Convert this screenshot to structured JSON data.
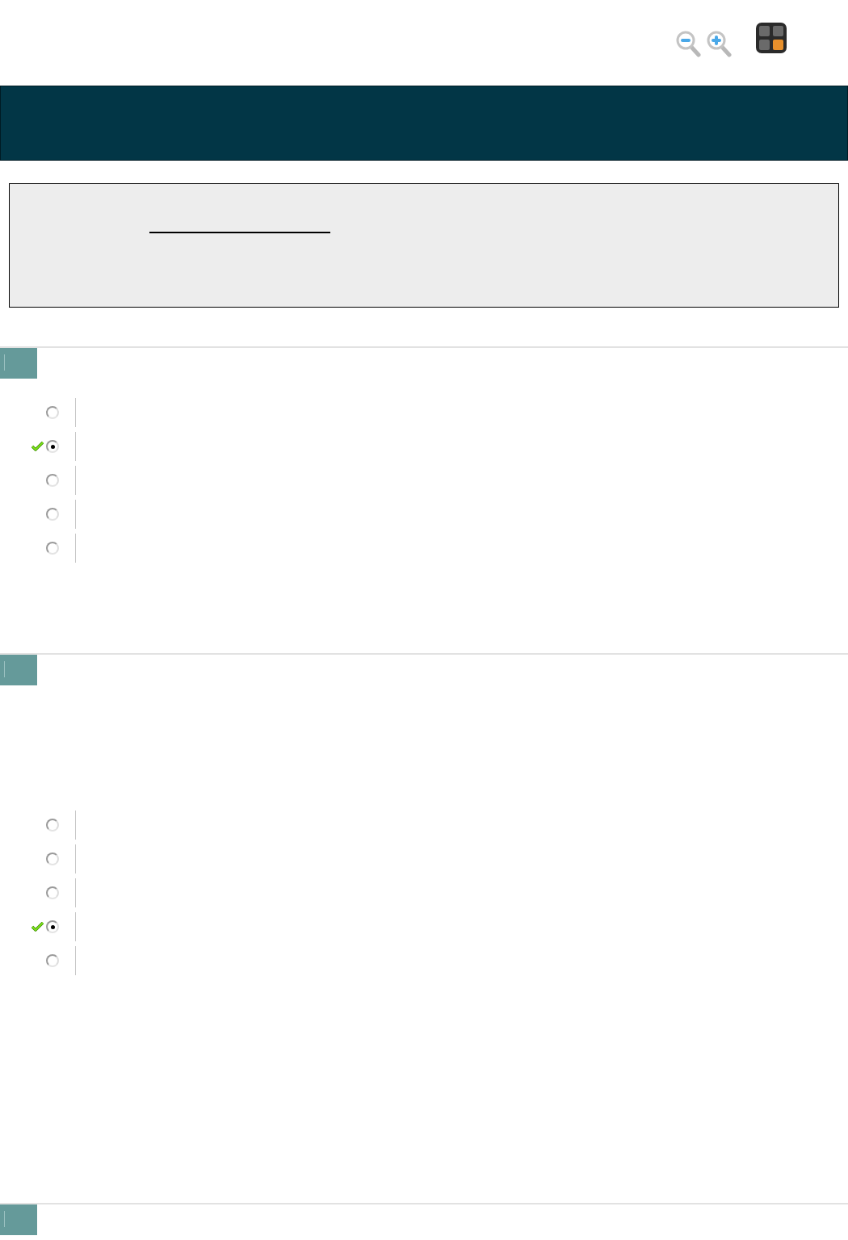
{
  "questions": [
    {
      "kind": "single_choice",
      "options": [
        {
          "selected": false,
          "correct": false
        },
        {
          "selected": true,
          "correct": true
        },
        {
          "selected": false,
          "correct": false
        },
        {
          "selected": false,
          "correct": false
        },
        {
          "selected": false,
          "correct": false
        }
      ]
    },
    {
      "kind": "single_choice",
      "options": [
        {
          "selected": false,
          "correct": false
        },
        {
          "selected": false,
          "correct": false
        },
        {
          "selected": false,
          "correct": false
        },
        {
          "selected": true,
          "correct": true
        },
        {
          "selected": false,
          "correct": false
        }
      ]
    },
    {
      "kind": "single_choice"
    }
  ]
}
